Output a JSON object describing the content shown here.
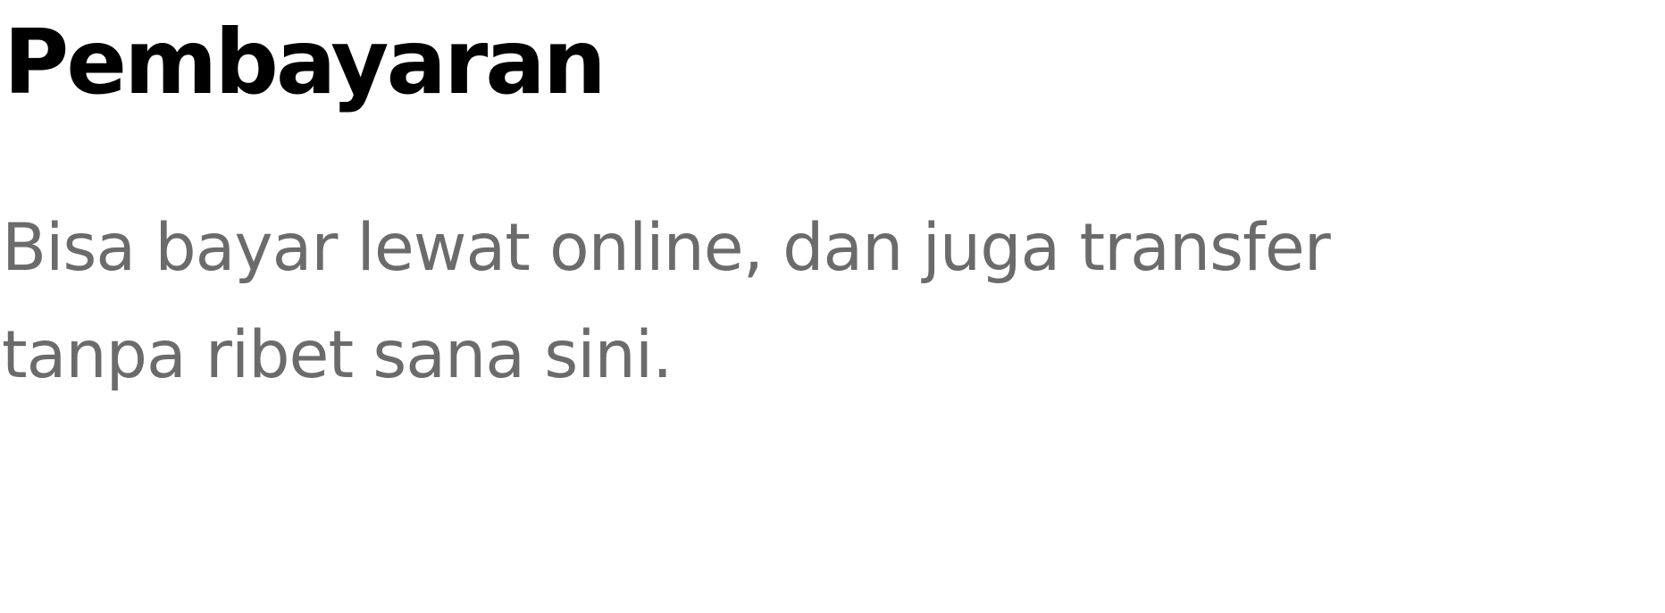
{
  "feature": {
    "title": "Pembayaran",
    "description": "Bisa bayar lewat online, dan juga transfer tanpa ribet sana sini."
  },
  "colors": {
    "title": "#000000",
    "description": "#6b6b6b",
    "background": "#ffffff"
  }
}
